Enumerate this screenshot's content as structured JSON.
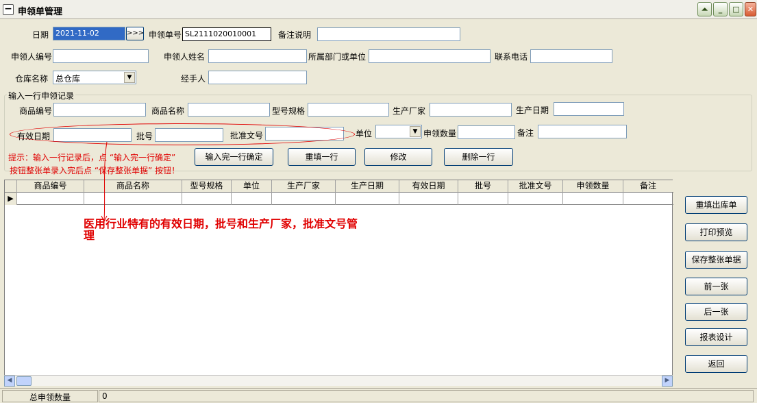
{
  "window": {
    "title": "申领单管理",
    "minimize": "_",
    "maximize": "□",
    "close": "✕",
    "restore": "⏶"
  },
  "header": {
    "date_label": "日期",
    "date_value": "2021-11-02",
    "date_btn": ">>>",
    "order_label": "申领单号",
    "order_value": "SL2111020010001",
    "remark_label": "备注说明",
    "remark_value": "",
    "applicant_id_label": "申领人编号",
    "applicant_id_value": "",
    "applicant_name_label": "申领人姓名",
    "applicant_name_value": "",
    "dept_label": "所属部门或单位",
    "dept_value": "",
    "phone_label": "联系电话",
    "phone_value": "",
    "warehouse_label": "仓库名称",
    "warehouse_value": "总仓库",
    "handler_label": "经手人",
    "handler_value": ""
  },
  "entry": {
    "group_title": "输入一行申领记录",
    "code_label": "商品编号",
    "name_label": "商品名称",
    "spec_label": "型号规格",
    "maker_label": "生产厂家",
    "mfg_label": "生产日期",
    "expiry_label": "有效日期",
    "batch_label": "批号",
    "approval_label": "批准文号",
    "unit_label": "单位",
    "qty_label": "申领数量",
    "note_label": "备注",
    "hint1": "提示：输入一行记录后，点 “输入完一行确定”",
    "hint2": "按钮整张单录入完后点 “保存整张单据” 按钮！",
    "confirm_btn": "输入完一行确定",
    "reset_btn": "重填一行",
    "edit_btn": "修改",
    "delete_btn": "删除一行"
  },
  "grid": {
    "columns": [
      "商品编号",
      "商品名称",
      "型号规格",
      "单位",
      "生产厂家",
      "生产日期",
      "有效日期",
      "批号",
      "批准文号",
      "申领数量",
      "备注"
    ],
    "row_indicator": "▶",
    "scroll_left": "◀",
    "scroll_right": "▶"
  },
  "annotation": "医用行业特有的有效日期，批号和生产厂家，批准文号管理",
  "side_buttons": [
    "重填出库单",
    "打印预览",
    "保存整张单据",
    "前一张",
    "后一张",
    "报表设计",
    "返回"
  ],
  "status": {
    "total_label": "总申领数量",
    "total_value": "0"
  },
  "colors": {
    "annotation": "#E00000",
    "selection": "#316AC5"
  }
}
